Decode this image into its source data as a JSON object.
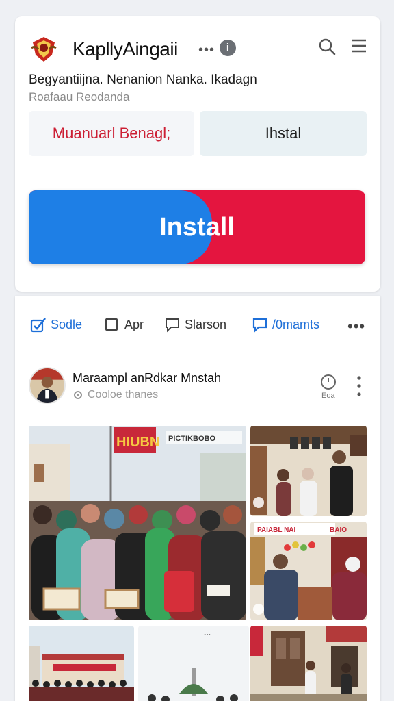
{
  "header": {
    "app_title": "KapllyAingaii",
    "subtitle": "Begyantiijna. Nenanion Nanka. Ikadagn",
    "subtitle2": "Roafaau Reodanda",
    "icons": {
      "logo": "emblem-logo",
      "more": "more-horizontal-icon",
      "info": "info-icon",
      "search": "search-icon",
      "menu": "hamburger-menu-icon"
    },
    "info_glyph": "i"
  },
  "buttons": {
    "left_label": "Muanuarl Benagl;",
    "right_label": "Ihstal",
    "install_label": "Install"
  },
  "colors": {
    "install_blue": "#1e7fe6",
    "install_red": "#e4153f",
    "accent_blue": "#1e6fd8",
    "red_text": "#cc1f34"
  },
  "actions": [
    {
      "label": "Sodle",
      "icon": "like-check-icon"
    },
    {
      "label": "Apr",
      "icon": "square-icon"
    },
    {
      "label": "Slarson",
      "icon": "comment-icon"
    },
    {
      "label": "/0mamts",
      "icon": "message-icon"
    }
  ],
  "post": {
    "title": "Maraampl anRdkar Mnstah",
    "subtitle": "Cooloe thanes",
    "stat_label": "Eoa",
    "photos": [
      {
        "name": "crowd-photo",
        "banner_text": "HIUBN",
        "overlay_text": "PICTIKBOBO"
      },
      {
        "name": "room-photo",
        "overlay_text": ""
      },
      {
        "name": "market-photo",
        "banner_text": "PAIABL NAI",
        "banner_text2": "BAIO"
      },
      {
        "name": "building-photo",
        "overlay_text": ""
      },
      {
        "name": "monument-photo",
        "overlay_text": "..."
      },
      {
        "name": "street-photo",
        "overlay_text": ""
      }
    ]
  }
}
